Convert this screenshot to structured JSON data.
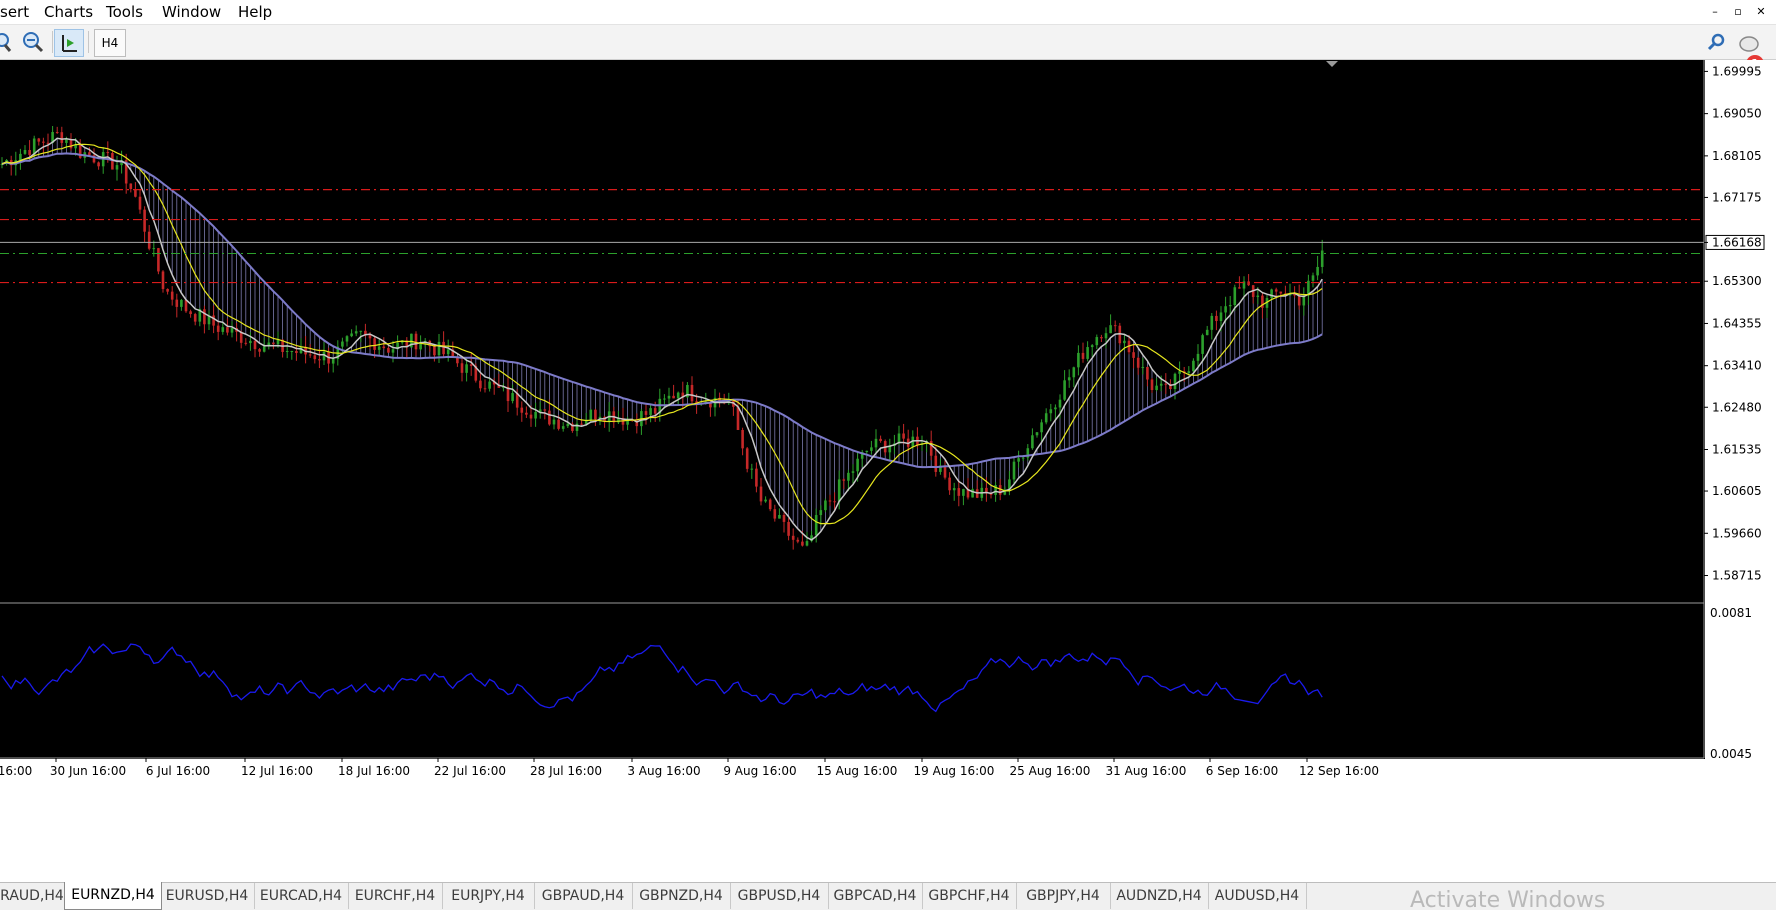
{
  "menu": {
    "items": [
      "sert",
      "Charts",
      "Tools",
      "Window",
      "Help"
    ]
  },
  "window_controls": {
    "minimize": "–",
    "restore": "▫",
    "close": "✕"
  },
  "toolbar": {
    "timeframe_label": "H4",
    "notification_count": "1"
  },
  "chart": {
    "price_scale": [
      "1.69995",
      "1.69050",
      "1.68105",
      "1.67175",
      "1.66168",
      "1.65300",
      "1.64355",
      "1.63410",
      "1.62480",
      "1.61535",
      "1.60605",
      "1.59660",
      "1.58715"
    ],
    "current_price": "1.66168",
    "oscillator_scale": [
      "0.0081",
      "0.0045"
    ],
    "time_labels": [
      "16:00",
      "30 Jun 16:00",
      "6 Jul 16:00",
      "12 Jul 16:00",
      "18 Jul 16:00",
      "22 Jul 16:00",
      "28 Jul 16:00",
      "3 Aug 16:00",
      "9 Aug 16:00",
      "15 Aug 16:00",
      "19 Aug 16:00",
      "25 Aug 16:00",
      "31 Aug 16:00",
      "6 Sep 16:00",
      "12 Sep 16:00"
    ],
    "colors": {
      "background": "#000000",
      "up_candle": "#2ca02c",
      "down_candle": "#c62828",
      "slow_ma": "#7d7bc9",
      "fast_ma": "#c8c8c8",
      "signal_ma": "#e6e61e",
      "oscillator": "#1a1aee",
      "level_red": "#d81b1b",
      "level_green": "#2ca02c"
    }
  },
  "tabs": [
    "RAUD,H4",
    "EURNZD,H4",
    "EURUSD,H4",
    "EURCAD,H4",
    "EURCHF,H4",
    "EURJPY,H4",
    "GBPAUD,H4",
    "GBPNZD,H4",
    "GBPUSD,H4",
    "GBPCAD,H4",
    "GBPCHF,H4",
    "GBPJPY,H4",
    "AUDNZD,H4",
    "AUDUSD,H4"
  ],
  "active_tab": "EURNZD,H4",
  "watermark": "Activate Windows"
}
